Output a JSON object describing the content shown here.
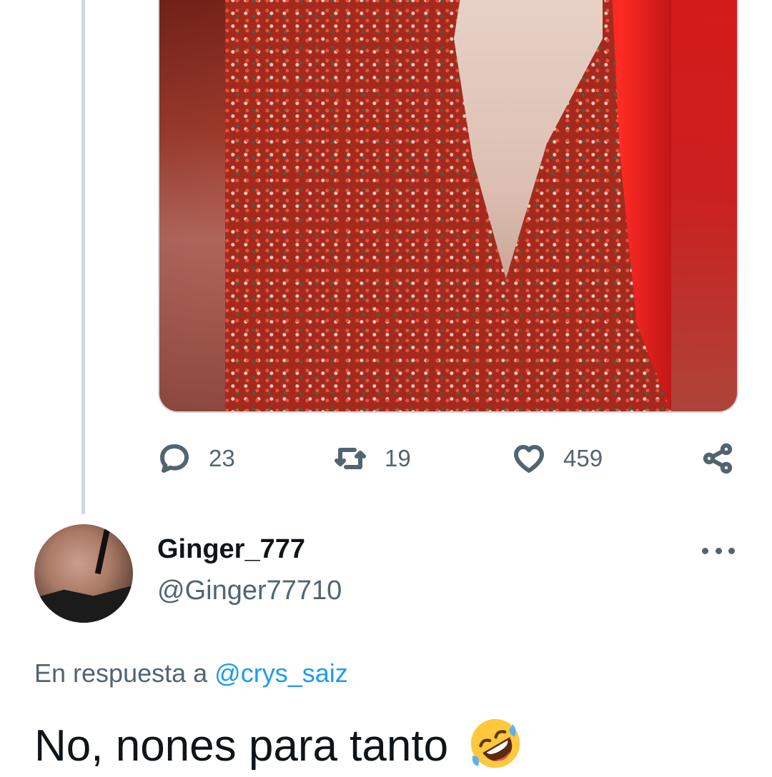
{
  "tweet_actions": {
    "replies": "23",
    "retweets": "19",
    "likes": "459",
    "icons": {
      "reply": "reply-icon",
      "retweet": "retweet-icon",
      "like": "heart-icon",
      "share": "share-icon"
    }
  },
  "reply_tweet": {
    "display_name": "Ginger_777",
    "handle": "@Ginger77710",
    "reply_prefix": "En respuesta a ",
    "reply_mention": "@crys_saiz",
    "text": "No, nones para tanto",
    "emoji": "rolling-on-floor-laughing-emoji"
  },
  "colors": {
    "primary_text": "#0f1419",
    "secondary_text": "#536471",
    "link": "#1d9bf0",
    "divider": "#cfd9de"
  }
}
